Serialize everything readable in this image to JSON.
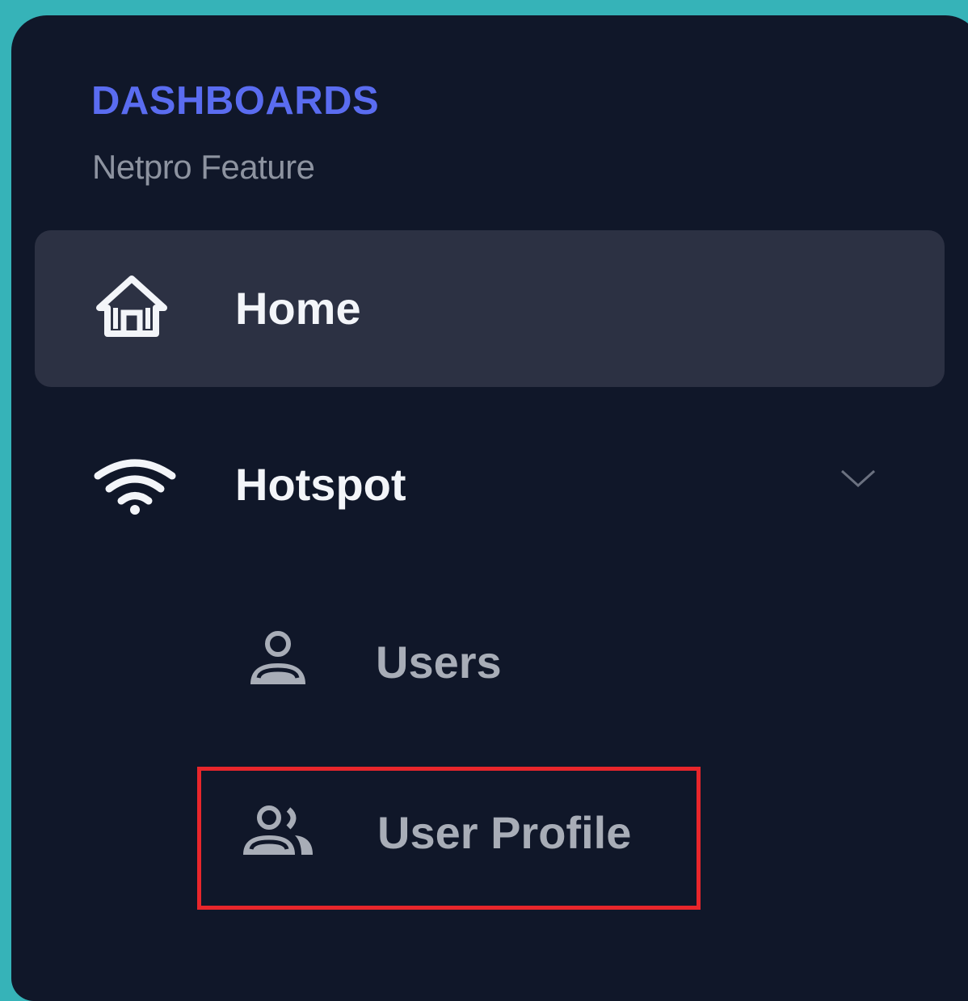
{
  "sidebar": {
    "section_title": "DASHBOARDS",
    "section_subtitle": "Netpro Feature",
    "items": [
      {
        "label": "Home",
        "icon": "home-icon",
        "active": true
      },
      {
        "label": "Hotspot",
        "icon": "wifi-icon",
        "expanded": true,
        "children": [
          {
            "label": "Users",
            "icon": "user-icon"
          },
          {
            "label": "User Profile",
            "icon": "user-group-icon",
            "highlighted": true
          }
        ]
      }
    ]
  },
  "colors": {
    "background": "#36b3b8",
    "panel": "#101729",
    "active_item": "#2c3143",
    "accent": "#5a6cf0",
    "highlight_border": "#e8262b"
  }
}
